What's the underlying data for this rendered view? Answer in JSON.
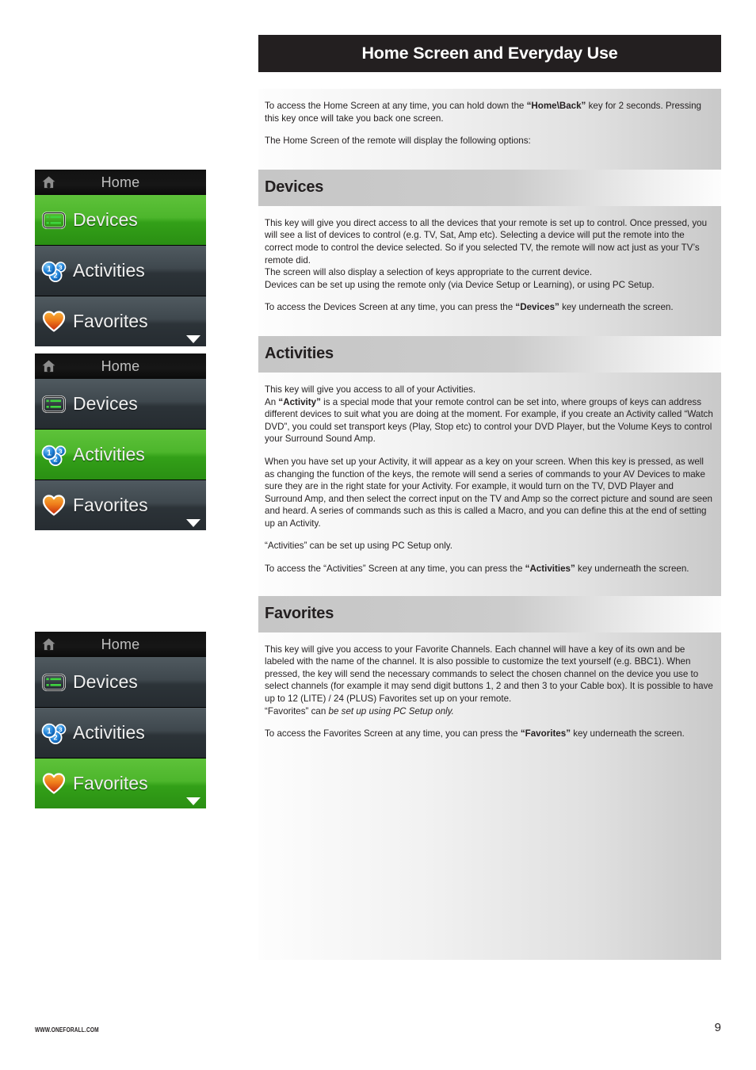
{
  "page": {
    "title": "Home Screen and Everyday Use",
    "footer_site": "WWW.ONEFORALL.COM",
    "footer_page_number": "9"
  },
  "intro": {
    "p1_a": "To access the Home Screen at any time, you can hold down the ",
    "p1_bold": "“Home\\Back”",
    "p1_b": " key for 2 seconds. Pressing this key once will take you back one screen.",
    "p2": "The Home Screen of the remote will display the following options:"
  },
  "sections": {
    "devices": {
      "heading": "Devices",
      "p1": "This key will give you direct access to all the devices that your remote is set up to control. Once pressed, you will see a list of devices to control (e.g. TV, Sat, Amp etc). Selecting a device will put the remote into the correct mode to control the device selected. So if you selected TV, the remote will now act just as your TV’s remote did.",
      "p2": "The screen will also display a selection of keys appropriate to the current device.",
      "p3": "Devices can be set up using the remote only (via Device Setup or Learning), or using PC Setup.",
      "p4_a": "To access the Devices Screen at any time, you can press the ",
      "p4_bold": "“Devices”",
      "p4_b": " key underneath the screen."
    },
    "activities": {
      "heading": "Activities",
      "p1": "This key will give you access to all of your Activities.",
      "p2_a": "An ",
      "p2_bold": "“Activity”",
      "p2_b": " is a special mode that your remote control can be set into, where groups of keys can address different devices to suit what you are doing at the moment. For example, if you create an Activity called “Watch DVD”, you could set transport keys (Play, Stop etc) to control your DVD Player, but the Volume Keys to control your Surround Sound Amp.",
      "p3": "When you have set up your Activity, it will appear as a key on your screen. When this key is pressed, as well as changing the function of the keys, the remote will send a series of commands to your AV Devices to make sure they are in the right state for your Activity. For example, it would turn on the TV, DVD Player and Surround Amp, and then select the correct input on the TV and Amp so the correct picture and sound are seen and heard. A series of commands such as this is called a Macro, and you can define this at the end of setting up an Activity.",
      "p4": "“Activities” can be set up using PC Setup only.",
      "p5_a": "To access the “Activities” Screen at any time, you can press the ",
      "p5_bold": "“Activities”",
      "p5_b": " key underneath the screen."
    },
    "favorites": {
      "heading": "Favorites",
      "p1_a": "This key will give you access to your Favorite Channels. Each channel will have a key of its own and be labeled with the name of the channel. It is also possible to customize the text yourself (e.g. BBC1). When pressed, the key will send the necessary commands to select the chosen channel on the device you use to select channels (for example it may send digit buttons 1, 2 and then 3 to your Cable box). It is possible to have up to 12 (LITE) / 24 (PLUS) Favorites set up on your remote.",
      "p2_a": "“Favorites” can ",
      "p2_italic": "be set up using PC Setup only.",
      "p3_a": "To access the Favorites Screen at any time, you can press the ",
      "p3_bold": "“Favorites”",
      "p3_b": " key underneath the screen."
    }
  },
  "remote_screens": {
    "titlebar_label": "Home",
    "menu_items": [
      {
        "label": "Devices",
        "icon": "devices-icon"
      },
      {
        "label": "Activities",
        "icon": "activities-icon"
      },
      {
        "label": "Favorites",
        "icon": "favorites-heart-icon"
      }
    ],
    "shots": [
      {
        "name": "home-screen-devices-selected",
        "selected": "Devices"
      },
      {
        "name": "home-screen-activities-selected",
        "selected": "Activities"
      },
      {
        "name": "home-screen-favorites-selected",
        "selected": "Favorites"
      }
    ]
  },
  "colors": {
    "selected_green": "#4db62c",
    "row_dark": "#3f484e",
    "titlebar_black": "#141414",
    "page_title_bar": "#231f20",
    "heart_orange": "#ef7d1a",
    "activities_blue": "#1a7fd4"
  }
}
